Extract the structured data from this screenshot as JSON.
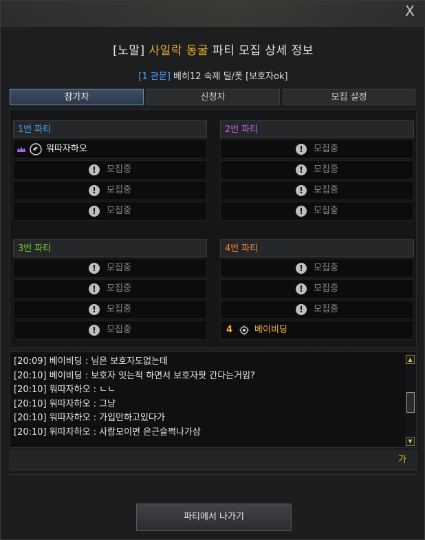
{
  "window": {
    "close_label": "X"
  },
  "title": {
    "prefix": "[노말] ",
    "highlight": "사일락 동굴",
    "suffix": " 파티 모집 상세 정보"
  },
  "subtitle": {
    "highlight": "[1 관문]",
    "text": " 베히12 숙제 딜/폿 [보호자ok]"
  },
  "tabs": [
    {
      "label": "참가자",
      "active": true
    },
    {
      "label": "신청자",
      "active": false
    },
    {
      "label": "모집 설정",
      "active": false
    }
  ],
  "recruiting_label": "모집중",
  "parties": [
    {
      "name": "1번 파티",
      "color": "#4da3ff",
      "members": [
        {
          "name": "워따자하오",
          "leader": true
        }
      ]
    },
    {
      "name": "2번 파티",
      "color": "#c060f0",
      "members": []
    },
    {
      "name": "3번 파티",
      "color": "#6cd13a",
      "members": []
    },
    {
      "name": "4번 파티",
      "color": "#f0853a",
      "members": [
        {
          "name": "베이비딩",
          "level": "4"
        }
      ]
    }
  ],
  "chat": {
    "lines": [
      "[20:09] 베이비딩 : 님은 보호자도없는데",
      "[20:10] 베이비딩 : 보호자 잇는척 하면서 보호자팟 간다는거임?",
      "[20:10] 워따자하오 : ㄴㄴ",
      "[20:10] 워따자하오 : 그냥",
      "[20:10] 워따자하오 : 가입만하고있다가",
      "[20:10] 워따자하오 : 사람모이면 은근슬쩍나가삼"
    ],
    "input_value": "",
    "mode_label": "가"
  },
  "leave_button": "파티에서 나가기"
}
